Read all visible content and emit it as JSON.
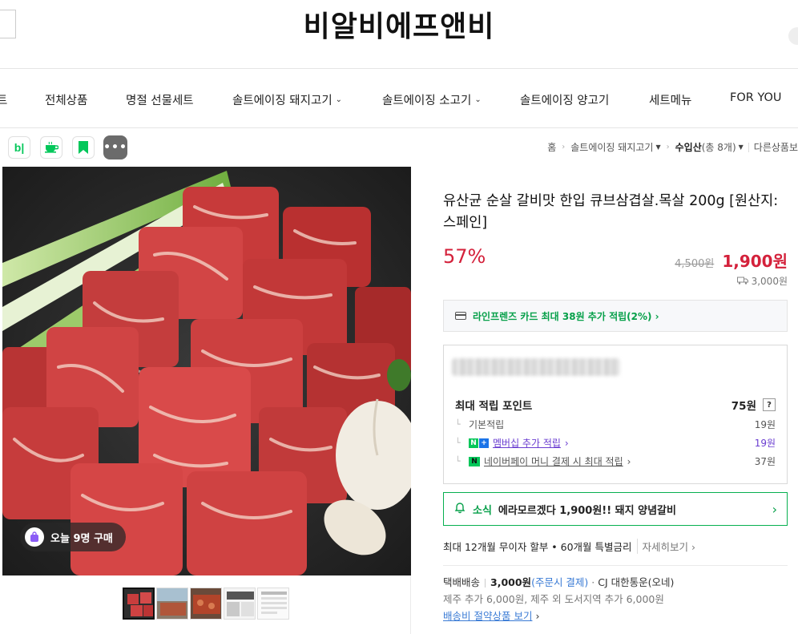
{
  "header": {
    "store_name": "비알비에프앤비"
  },
  "nav": {
    "items": [
      {
        "label": "트",
        "dropdown": false
      },
      {
        "label": "전체상품",
        "dropdown": false
      },
      {
        "label": "명절 선물세트",
        "dropdown": false
      },
      {
        "label": "솔트에이징 돼지고기",
        "dropdown": true
      },
      {
        "label": "솔트에이징 소고기",
        "dropdown": true
      },
      {
        "label": "솔트에이징 양고기",
        "dropdown": false
      },
      {
        "label": "세트메뉴",
        "dropdown": false
      },
      {
        "label": "FOR YOU",
        "dropdown": false
      }
    ]
  },
  "toolbar": {
    "blog_icon_text": "b|",
    "more_text": "•••"
  },
  "breadcrumb": {
    "home": "홈",
    "category": "솔트에이징 돼지고기",
    "current": "수입산",
    "count": "(총 8개)",
    "other": "다른상품보"
  },
  "gallery": {
    "buy_badge": "오늘 9명 구매"
  },
  "product": {
    "title": "유산균 순살 갈비맛 한입 큐브삼겹살.목살 200g [원산지:스페인]",
    "discount": "57%",
    "original_price": "4,500원",
    "sale_price": "1,900원",
    "shipping_fee": "3,000원"
  },
  "card_benefit": {
    "text": "라인프렌즈 카드 최대 38원 추가 적립(2%) ›"
  },
  "points": {
    "max_label": "최대 적립 포인트",
    "max_value": "75원",
    "help": "?",
    "basic_label": "기본적립",
    "basic_value": "19원",
    "membership_label": "멤버십 추가 적립",
    "membership_value": "19원",
    "npay_label": "네이버페이 머니 결제 시 최대 적립",
    "npay_value": "37원"
  },
  "news": {
    "label": "소식",
    "text": "에라모르겠다 1,900원!! 돼지 양념갈비"
  },
  "installment": {
    "text": "최대 12개월 무이자 할부 • 60개월 특별금리",
    "more": "자세히보기 ›"
  },
  "delivery": {
    "method": "택배배송",
    "fee": "3,000원",
    "fee_note": "(주문시 결제)",
    "carrier": "CJ 대한통운(오네)",
    "extra": "제주 추가 6,000원, 제주 외 도서지역 추가 6,000원",
    "saving_link": "배송비 절약상품 보기"
  },
  "colors": {
    "accent_red": "#d4213b",
    "naver_green": "#03c75a"
  }
}
